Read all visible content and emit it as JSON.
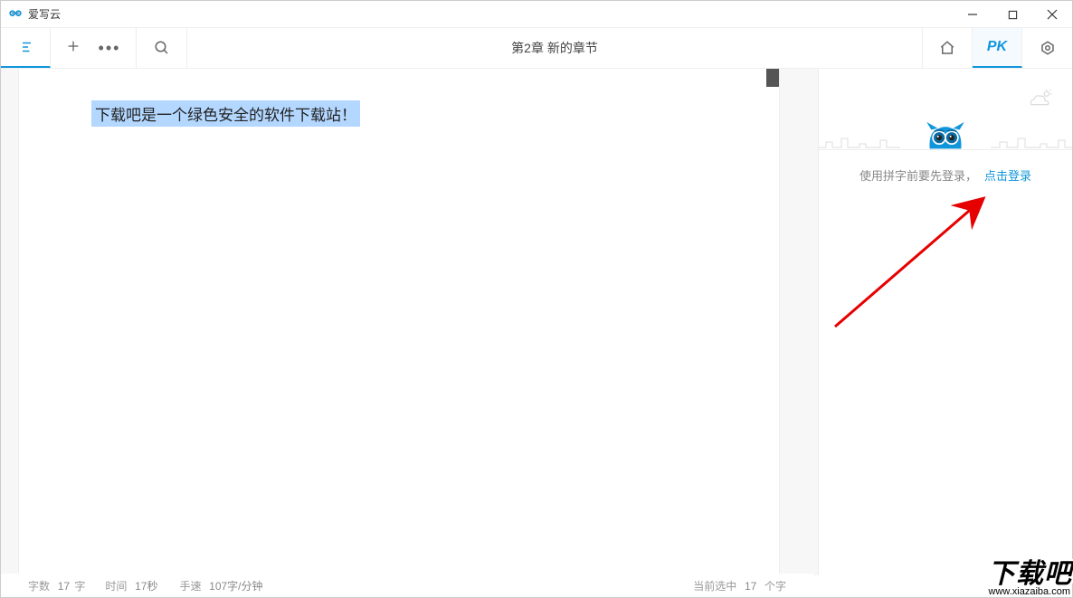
{
  "app": {
    "title": "爱写云"
  },
  "toolbar": {
    "chapter_title": "第2章  新的章节",
    "pk_label": "PK"
  },
  "editor": {
    "content": "下载吧是一个绿色安全的软件下载站！"
  },
  "sidebar": {
    "login_prompt": "使用拼字前要先登录，",
    "login_link": "点击登录"
  },
  "statusbar": {
    "wordcount_label": "字数",
    "wordcount_value": "17",
    "wordcount_unit": "字",
    "time_label": "时间",
    "time_value": "17秒",
    "speed_label": "手速",
    "speed_value": "107字/分钟",
    "selection_label": "当前选中",
    "selection_value": "17",
    "selection_unit": "个字"
  },
  "watermark": {
    "main": "下载吧",
    "sub": "www.xiazaiba.com"
  }
}
